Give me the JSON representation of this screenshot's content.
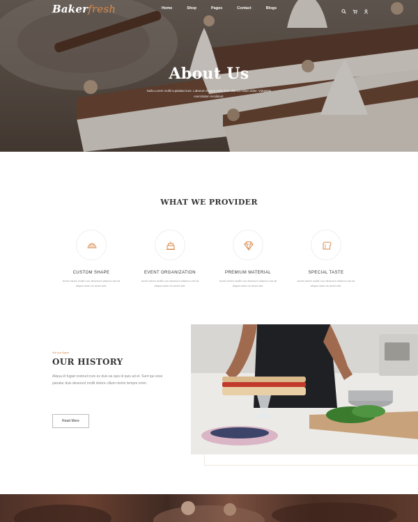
{
  "brand": {
    "name_main": "Baker",
    "name_accent": "fresh",
    "accent_color": "#d98a4a"
  },
  "nav": {
    "items": [
      "Home",
      "Shop",
      "Pages",
      "Contact",
      "Blogs"
    ],
    "icons": [
      "search-icon",
      "cart-icon",
      "user-icon"
    ]
  },
  "hero": {
    "title": "About Us",
    "subtitle": "Nulla Lorem mollit cupidatat irure. Laborum magna nulla duis ullamco cillum dolor. Voluptate exercitation incididunt."
  },
  "provider": {
    "title": "WHAT WE PROVIDER",
    "features": [
      {
        "icon": "croissant-icon",
        "title": "CUSTOM SHAPE",
        "desc": "Amet minim mollit non deserunt ullamco est sit aliqua dolor do amet sint."
      },
      {
        "icon": "cake-icon",
        "title": "EVENT ORGANIZATION",
        "desc": "Amet minim mollit non deserunt ullamco est sit aliqua dolor do amet sint."
      },
      {
        "icon": "diamond-icon",
        "title": "PREMIUM MATERIAL",
        "desc": "Amet minim mollit non deserunt ullamco est sit aliqua dolor do amet sint."
      },
      {
        "icon": "bread-icon",
        "title": "SPECIAL TASTE",
        "desc": "Amet minim mollit non deserunt ullamco est sit aliqua dolor do amet sint."
      }
    ]
  },
  "history": {
    "kicker": "We Are Baker",
    "title": "OUR HISTORY",
    "text": "Aliqua id fugiat nostrud irure ex duis ea quis id quis ad et. Sunt qui esse pariatur duis deserunt mollit dolore cillum minim tempor enim.",
    "button": "Read More"
  }
}
